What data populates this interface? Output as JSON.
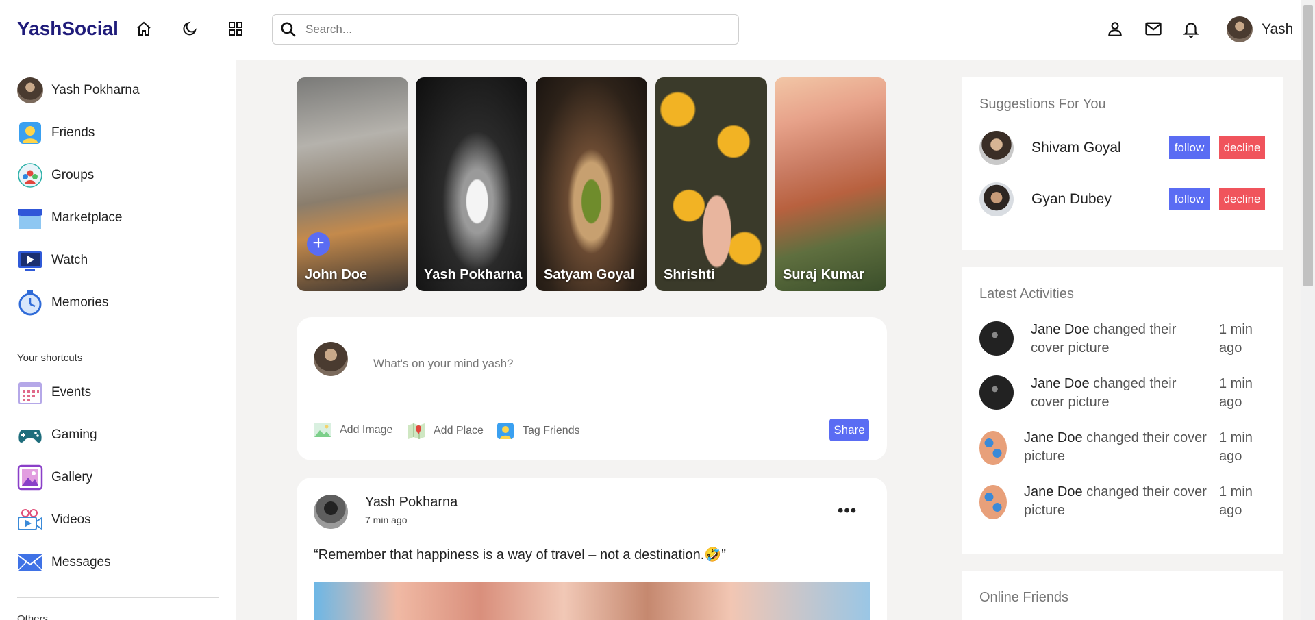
{
  "navbar": {
    "logo": "YashSocial",
    "search_placeholder": "Search...",
    "user_name": "Yash"
  },
  "sidebar": {
    "items": [
      {
        "label": "Yash Pokharna"
      },
      {
        "label": "Friends"
      },
      {
        "label": "Groups"
      },
      {
        "label": "Marketplace"
      },
      {
        "label": "Watch"
      },
      {
        "label": "Memories"
      }
    ],
    "shortcuts_heading": "Your shortcuts",
    "shortcuts": [
      {
        "label": "Events"
      },
      {
        "label": "Gaming"
      },
      {
        "label": "Gallery"
      },
      {
        "label": "Videos"
      },
      {
        "label": "Messages"
      }
    ],
    "others_heading": "Others"
  },
  "stories": [
    {
      "name": "John Doe",
      "icon": "plus-icon"
    },
    {
      "name": "Yash Pokharna"
    },
    {
      "name": "Satyam Goyal"
    },
    {
      "name": "Shrishti"
    },
    {
      "name": "Suraj Kumar"
    }
  ],
  "create_post": {
    "placeholder": "What's on your mind yash?",
    "add_image": "Add Image",
    "add_place": "Add Place",
    "tag_friends": "Tag Friends",
    "share": "Share"
  },
  "post": {
    "author": "Yash Pokharna",
    "time": "7 min ago",
    "text": "“Remember that happiness is a way of travel – not a destination.🤣”",
    "more": "•••"
  },
  "suggestions": {
    "title": "Suggestions For You",
    "people": [
      {
        "name": "Shivam Goyal",
        "follow": "follow",
        "decline": "decline"
      },
      {
        "name": "Gyan Dubey",
        "follow": "follow",
        "decline": "decline"
      }
    ]
  },
  "activities": {
    "title": "Latest Activities",
    "items": [
      {
        "name": "Jane Doe",
        "line1": " changed their",
        "line2": "cover picture",
        "time": "1 min ago"
      },
      {
        "name": "Jane Doe",
        "line1": " changed their",
        "line2": "cover picture",
        "time": "1 min ago"
      },
      {
        "name": "Jane Doe",
        "line1": " changed their cover",
        "line2": "picture",
        "time": "1 min ago"
      },
      {
        "name": "Jane Doe",
        "line1": " changed their cover",
        "line2": "picture",
        "time": "1 min ago"
      }
    ]
  },
  "online_friends": {
    "title": "Online Friends"
  },
  "colors": {
    "brand": "#1f1b7a",
    "accent": "#5a6cf3",
    "decline": "#f0545c",
    "background": "#f4f3f2"
  }
}
